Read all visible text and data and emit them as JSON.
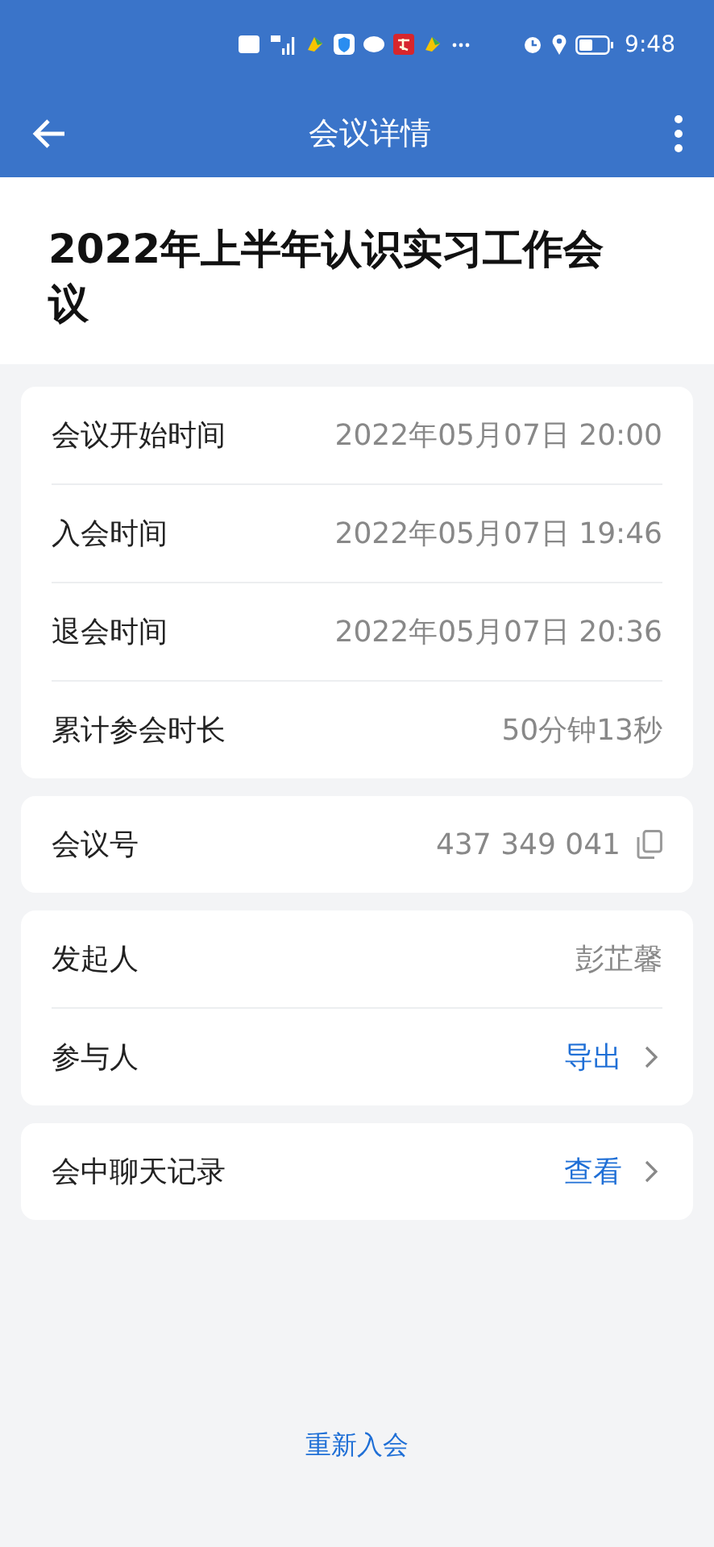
{
  "status_bar": {
    "time": "9:48"
  },
  "header": {
    "title": "会议详情"
  },
  "meeting_title": "2022年上半年认识实习工作会议",
  "cards": [
    {
      "rows": [
        {
          "kind": "text",
          "label": "会议开始时间",
          "value": "2022年05月07日 20:00"
        },
        {
          "kind": "text",
          "label": "入会时间",
          "value": "2022年05月07日 19:46"
        },
        {
          "kind": "text",
          "label": "退会时间",
          "value": "2022年05月07日 20:36"
        },
        {
          "kind": "text",
          "label": "累计参会时长",
          "value": "50分钟13秒"
        }
      ]
    },
    {
      "rows": [
        {
          "kind": "copy",
          "label": "会议号",
          "value": "437 349 041"
        }
      ]
    },
    {
      "rows": [
        {
          "kind": "text",
          "label": "发起人",
          "value": "彭芷馨"
        },
        {
          "kind": "link",
          "label": "参与人",
          "value": "导出"
        }
      ]
    },
    {
      "rows": [
        {
          "kind": "link",
          "label": "会中聊天记录",
          "value": "查看"
        }
      ]
    }
  ],
  "bottom_action": "重新入会"
}
